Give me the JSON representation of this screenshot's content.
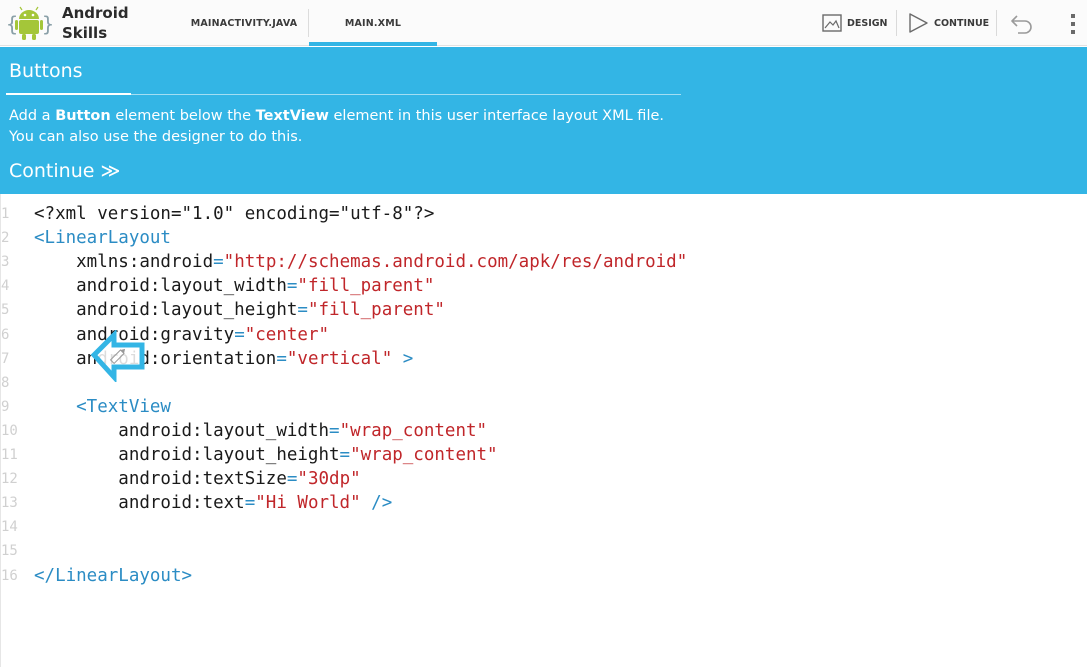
{
  "app": {
    "name_line1": "Android",
    "name_line2": "Skills"
  },
  "tabs": [
    {
      "label": "MAINACTIVITY.JAVA",
      "active": false
    },
    {
      "label": "MAIN.XML",
      "active": true
    }
  ],
  "actions": {
    "design_label": "DESIGN",
    "continue_label": "CONTINUE"
  },
  "lesson": {
    "title": "Buttons",
    "text_part1": "Add a ",
    "text_bold1": "Button",
    "text_part2": " element below the ",
    "text_bold2": "TextView",
    "text_part3": " element in this user interface layout XML file.",
    "text_line2": "You can also use the designer to do this.",
    "continue_label": "Continue ≫"
  },
  "editor": {
    "lines": [
      {
        "n": "1",
        "tokens": [
          {
            "t": "<?xml version=\"1.0\" encoding=\"utf-8\"?>",
            "c": "plain"
          }
        ]
      },
      {
        "n": "2",
        "tokens": [
          {
            "t": "<LinearLayout",
            "c": "tag"
          }
        ]
      },
      {
        "n": "3",
        "tokens": [
          {
            "t": "    xmlns:android",
            "c": "plain"
          },
          {
            "t": "=",
            "c": "eq"
          },
          {
            "t": "\"http://schemas.android.com/apk/res/android\"",
            "c": "str"
          }
        ]
      },
      {
        "n": "4",
        "tokens": [
          {
            "t": "    android:layout_width",
            "c": "plain"
          },
          {
            "t": "=",
            "c": "eq"
          },
          {
            "t": "\"fill_parent\"",
            "c": "str"
          }
        ]
      },
      {
        "n": "5",
        "tokens": [
          {
            "t": "    android:layout_height",
            "c": "plain"
          },
          {
            "t": "=",
            "c": "eq"
          },
          {
            "t": "\"fill_parent\"",
            "c": "str"
          }
        ]
      },
      {
        "n": "6",
        "tokens": [
          {
            "t": "    android:gravity",
            "c": "plain"
          },
          {
            "t": "=",
            "c": "eq"
          },
          {
            "t": "\"center\"",
            "c": "str"
          }
        ]
      },
      {
        "n": "7",
        "tokens": [
          {
            "t": "    android:orientation",
            "c": "plain"
          },
          {
            "t": "=",
            "c": "eq"
          },
          {
            "t": "\"vertical\"",
            "c": "str"
          },
          {
            "t": " >",
            "c": "tag"
          }
        ]
      },
      {
        "n": "8",
        "tokens": []
      },
      {
        "n": "9",
        "tokens": [
          {
            "t": "    <TextView",
            "c": "tag"
          }
        ]
      },
      {
        "n": "10",
        "tokens": [
          {
            "t": "        android:layout_width",
            "c": "plain"
          },
          {
            "t": "=",
            "c": "eq"
          },
          {
            "t": "\"wrap_content\"",
            "c": "str"
          }
        ]
      },
      {
        "n": "11",
        "tokens": [
          {
            "t": "        android:layout_height",
            "c": "plain"
          },
          {
            "t": "=",
            "c": "eq"
          },
          {
            "t": "\"wrap_content\"",
            "c": "str"
          }
        ]
      },
      {
        "n": "12",
        "tokens": [
          {
            "t": "        android:textSize",
            "c": "plain"
          },
          {
            "t": "=",
            "c": "eq"
          },
          {
            "t": "\"30dp\"",
            "c": "str"
          }
        ]
      },
      {
        "n": "13",
        "tokens": [
          {
            "t": "        android:text",
            "c": "plain"
          },
          {
            "t": "=",
            "c": "eq"
          },
          {
            "t": "\"Hi World\"",
            "c": "str"
          },
          {
            "t": " />",
            "c": "tag"
          }
        ]
      },
      {
        "n": "14",
        "tokens": []
      },
      {
        "n": "15",
        "tokens": []
      },
      {
        "n": "16",
        "tokens": [
          {
            "t": "</LinearLayout>",
            "c": "tag"
          }
        ]
      }
    ]
  },
  "icons": {
    "app": "android-robot-icon",
    "design": "design-image-icon",
    "continue": "play-triangle-icon",
    "undo": "undo-icon",
    "overflow": "overflow-menu-icon",
    "drag": "drag-arrow-icon"
  },
  "colors": {
    "accent": "#33b5e5",
    "android_green": "#a4c639",
    "tag": "#2b8cc4",
    "string": "#c0262a"
  }
}
